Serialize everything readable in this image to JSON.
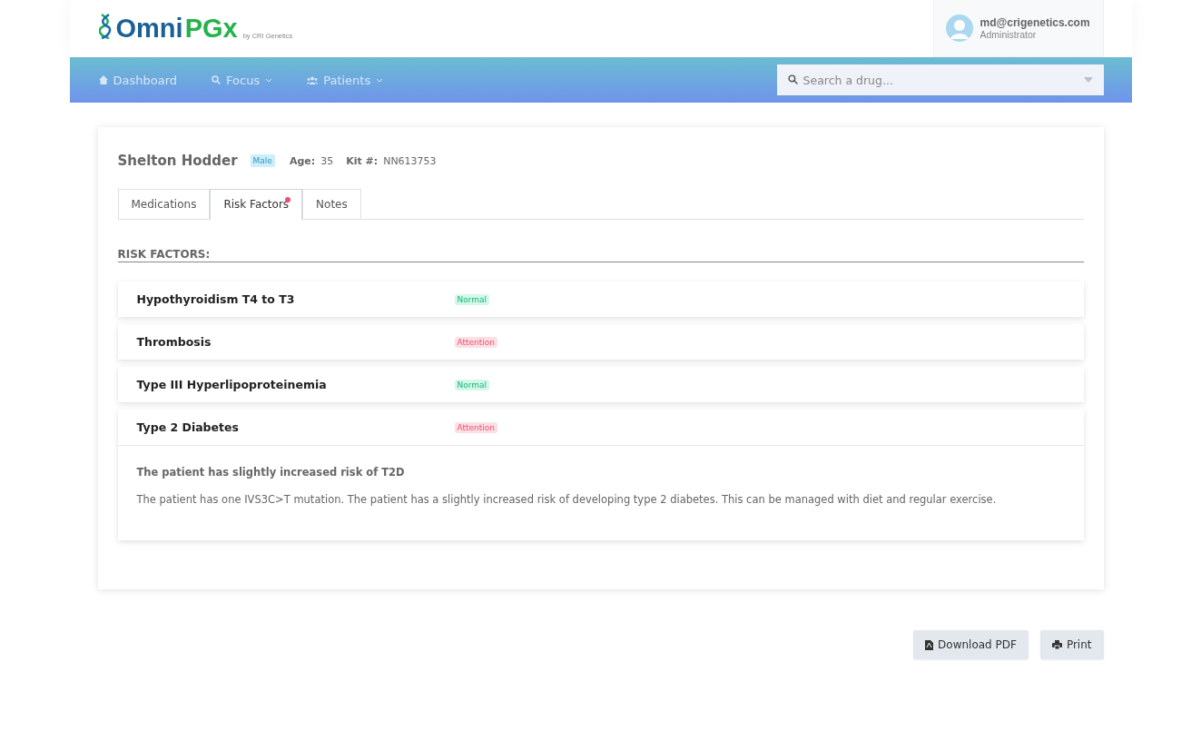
{
  "logo": {
    "brand_primary": "Omni",
    "brand_accent": "PGx",
    "byline": "by CRI Genetics"
  },
  "user": {
    "email": "md@crigenetics.com",
    "role": "Administrator"
  },
  "nav": [
    {
      "label": "Dashboard",
      "dropdown": false
    },
    {
      "label": "Focus",
      "dropdown": true
    },
    {
      "label": "Patients",
      "dropdown": true
    }
  ],
  "search": {
    "placeholder": "Search a drug..."
  },
  "patient": {
    "name": "Shelton Hodder",
    "sex": "Male",
    "age_label": "Age:",
    "age": "35",
    "kit_label": "Kit #:",
    "kit": "NN613753"
  },
  "tabs": [
    {
      "label": "Medications",
      "selected": false,
      "alert": false
    },
    {
      "label": "Risk Factors",
      "selected": true,
      "alert": true
    },
    {
      "label": "Notes",
      "selected": false,
      "alert": false
    }
  ],
  "section_title": "RISK FACTORS:",
  "risk_factors": [
    {
      "name": "Hypothyroidism T4 to T3",
      "status": "Normal",
      "kind": "normal",
      "expanded": false
    },
    {
      "name": "Thrombosis",
      "status": "Attention",
      "kind": "attention",
      "expanded": false
    },
    {
      "name": "Type III Hyperlipoproteinemia",
      "status": "Normal",
      "kind": "normal",
      "expanded": false
    },
    {
      "name": "Type 2 Diabetes",
      "status": "Attention",
      "kind": "attention",
      "expanded": true,
      "detail_title": "The patient has slightly increased risk of T2D",
      "detail_text": "The patient has one IVS3C>T mutation. The patient has a slightly increased risk of developing type 2 diabetes. This can be managed with diet and regular exercise."
    }
  ],
  "buttons": [
    {
      "label": "Download PDF"
    },
    {
      "label": "Print"
    }
  ]
}
